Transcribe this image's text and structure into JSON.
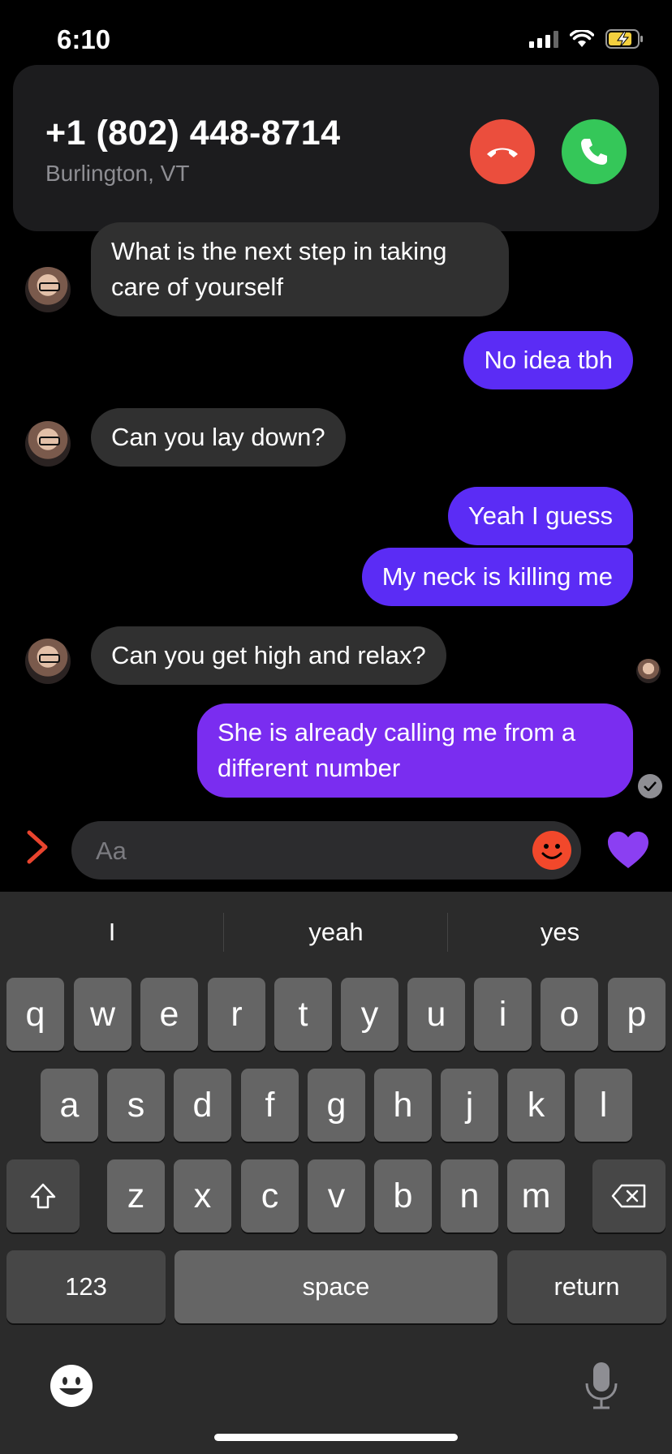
{
  "status_bar": {
    "time": "6:10"
  },
  "call": {
    "number": "+1 (802) 448-8714",
    "location": "Burlington, VT"
  },
  "messages": [
    {
      "side": "in",
      "text": "What is the next step in taking care of yourself"
    },
    {
      "side": "out",
      "text": "No idea tbh"
    },
    {
      "side": "in",
      "text": "Can you lay down?"
    },
    {
      "side": "out",
      "text": "Yeah I guess"
    },
    {
      "side": "out",
      "text": "My neck is killing me"
    },
    {
      "side": "in",
      "text": "Can you get high and relax?"
    },
    {
      "side": "out",
      "text": "She is already calling me from a different number"
    }
  ],
  "composer": {
    "placeholder": "Aa"
  },
  "keyboard": {
    "suggestions": [
      "I",
      "yeah",
      "yes"
    ],
    "row1": [
      "q",
      "w",
      "e",
      "r",
      "t",
      "y",
      "u",
      "i",
      "o",
      "p"
    ],
    "row2": [
      "a",
      "s",
      "d",
      "f",
      "g",
      "h",
      "j",
      "k",
      "l"
    ],
    "row3": [
      "z",
      "x",
      "c",
      "v",
      "b",
      "n",
      "m"
    ],
    "numbers_label": "123",
    "space_label": "space",
    "return_label": "return"
  },
  "colors": {
    "outgoing_bubble": "#5b2cf5",
    "incoming_bubble": "#303030",
    "decline": "#eb4e3d",
    "accept": "#35c759"
  }
}
